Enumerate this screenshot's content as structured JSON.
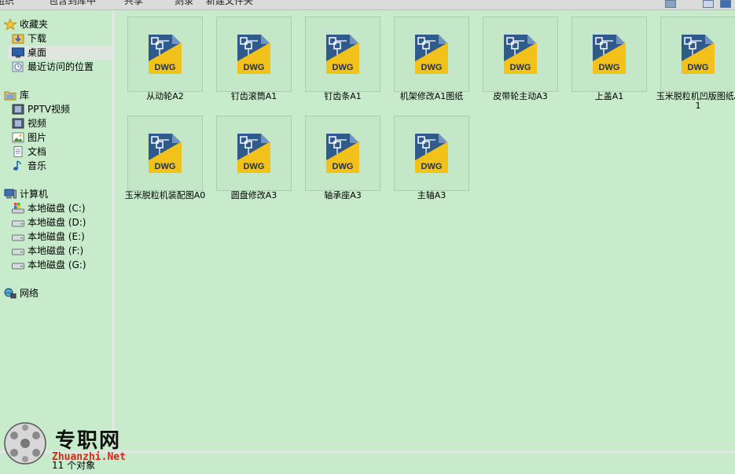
{
  "toolbar": {
    "items": [
      "组织",
      "包含到库中",
      "共享",
      "刻录",
      "新建文件夹"
    ]
  },
  "nav": {
    "favorites": {
      "label": "收藏夹",
      "items": [
        "下载",
        "桌面",
        "最近访问的位置"
      ],
      "selected": "桌面"
    },
    "libraries": {
      "label": "库",
      "items": [
        "PPTV视频",
        "视频",
        "图片",
        "文档",
        "音乐"
      ]
    },
    "computer": {
      "label": "计算机",
      "drives": [
        "本地磁盘 (C:)",
        "本地磁盘 (D:)",
        "本地磁盘 (E:)",
        "本地磁盘 (F:)",
        "本地磁盘 (G:)"
      ]
    },
    "network": {
      "label": "网络"
    }
  },
  "files": [
    {
      "name": "从动轮A2",
      "icon": "dwg-file-icon",
      "icon_label": "DWG"
    },
    {
      "name": "钉齿滚筒A1",
      "icon": "dwg-file-icon",
      "icon_label": "DWG"
    },
    {
      "name": "钉齿条A1",
      "icon": "dwg-file-icon",
      "icon_label": "DWG"
    },
    {
      "name": "机架修改A1图纸",
      "icon": "dwg-file-icon",
      "icon_label": "DWG"
    },
    {
      "name": "皮带轮主动A3",
      "icon": "dwg-file-icon",
      "icon_label": "DWG"
    },
    {
      "name": "上盖A1",
      "icon": "dwg-file-icon",
      "icon_label": "DWG"
    },
    {
      "name": "玉米脱粒机凹版图纸A1",
      "icon": "dwg-file-icon",
      "icon_label": "DWG"
    },
    {
      "name": "玉米脱粒机装配图A0",
      "icon": "dwg-file-icon",
      "icon_label": "DWG"
    },
    {
      "name": "圆盘修改A3",
      "icon": "dwg-file-icon",
      "icon_label": "DWG"
    },
    {
      "name": "轴承座A3",
      "icon": "dwg-file-icon",
      "icon_label": "DWG"
    },
    {
      "name": "主轴A3",
      "icon": "dwg-file-icon",
      "icon_label": "DWG"
    }
  ],
  "status": {
    "count": "11 个对象"
  },
  "watermark": {
    "cn": "专职网",
    "en": "Zhuanzhi.Net"
  },
  "colors": {
    "background": "#c8eccb",
    "selection": "#dfe5df",
    "dwg_yellow": "#f2c11a",
    "dwg_blue": "#2f5b8c",
    "watermark_red": "#d42a16"
  }
}
